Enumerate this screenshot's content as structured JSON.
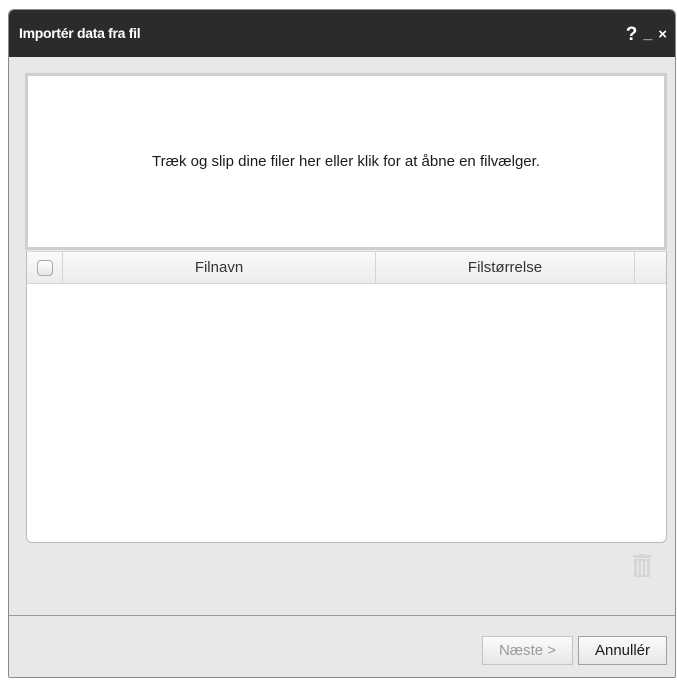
{
  "dialog": {
    "title": "Importér data fra fil",
    "controls": {
      "help": "?",
      "minimize": "_",
      "close": "×"
    }
  },
  "dropzone": {
    "text": "Træk og slip dine filer her eller klik for at åbne en filvælger."
  },
  "filelist": {
    "columns": {
      "name": "Filnavn",
      "size": "Filstørrelse"
    },
    "rows": []
  },
  "actions": {
    "delete_icon": "trash-icon"
  },
  "footer": {
    "next_label": "Næste >",
    "cancel_label": "Annullér",
    "next_enabled": false
  },
  "colors": {
    "titlebar": "#2b2b2b",
    "dialog_bg": "#e8e8e8",
    "disabled_text": "#9a9a9a"
  }
}
